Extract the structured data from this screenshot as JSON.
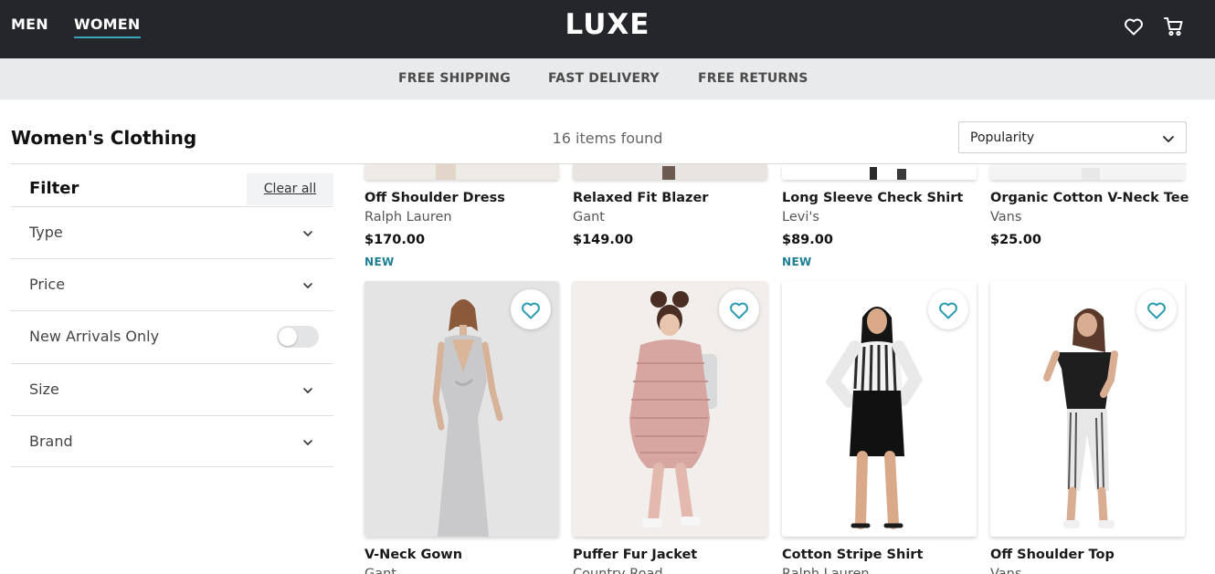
{
  "nav": {
    "men": "MEN",
    "women": "WOMEN",
    "logo": "LUXE",
    "wishlist_icon": "heart-outline-icon",
    "cart_icon": "shopping-cart-icon"
  },
  "perks": [
    "FREE SHIPPING",
    "FAST DELIVERY",
    "FREE RETURNS"
  ],
  "page": {
    "title": "Women's Clothing",
    "items_found": "16 items found",
    "sort_selected": "Popularity"
  },
  "filter": {
    "title": "Filter",
    "clear_all": "Clear all",
    "rows": [
      {
        "label": "Type",
        "control": "chevron-down-icon"
      },
      {
        "label": "Price",
        "control": "chevron-down-icon"
      },
      {
        "label": "New Arrivals Only",
        "control": "toggle",
        "toggle_on": false
      },
      {
        "label": "Size",
        "control": "chevron-down-icon"
      },
      {
        "label": "Brand",
        "control": "chevron-down-icon"
      }
    ]
  },
  "products": [
    {
      "name": "Off Shoulder Dress",
      "brand": "Ralph Lauren",
      "price": "$170.00",
      "badge": "NEW"
    },
    {
      "name": "Relaxed Fit Blazer",
      "brand": "Gant",
      "price": "$149.00",
      "badge": ""
    },
    {
      "name": "Long Sleeve Check Shirt",
      "brand": "Levi's",
      "price": "$89.00",
      "badge": "NEW"
    },
    {
      "name": "Organic Cotton V-Neck Tee",
      "brand": "Vans",
      "price": "$25.00",
      "badge": ""
    },
    {
      "name": "V-Neck Gown",
      "brand": "Gant",
      "price": "",
      "badge": ""
    },
    {
      "name": "Puffer Fur Jacket",
      "brand": "Country Road",
      "price": "",
      "badge": ""
    },
    {
      "name": "Cotton Stripe Shirt",
      "brand": "Ralph Lauren",
      "price": "",
      "badge": ""
    },
    {
      "name": "Off Shoulder Top",
      "brand": "Vans",
      "price": "",
      "badge": ""
    }
  ],
  "colors": {
    "topbar": "#25262b",
    "accent": "#3aa6b9",
    "badge": "#1d7f93",
    "wish_heart": "#2a9bb0"
  }
}
